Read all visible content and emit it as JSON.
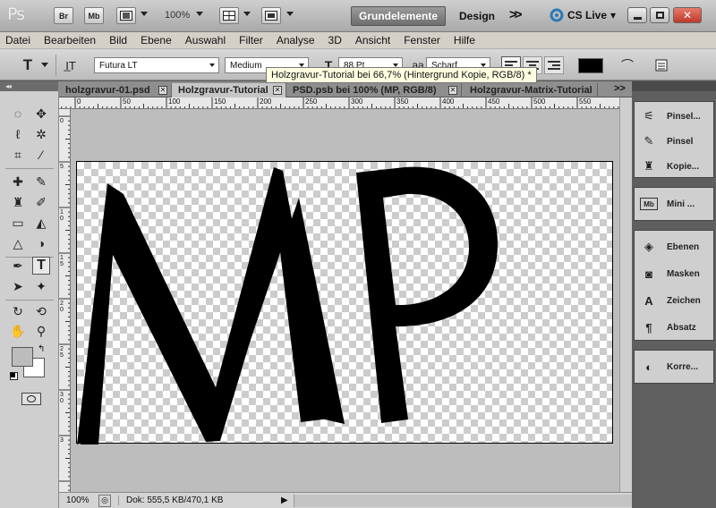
{
  "appbar": {
    "logo": "Ps",
    "bridge_label": "Br",
    "minibridge_label": "Mb",
    "zoom": "100%",
    "workspace_active": "Grundelemente",
    "workspace_other": "Design",
    "more_label": ">>",
    "cslive": "CS Live",
    "cslive_dropdown": "▾"
  },
  "menu": [
    "Datei",
    "Bearbeiten",
    "Bild",
    "Ebene",
    "Auswahl",
    "Filter",
    "Analyse",
    "3D",
    "Ansicht",
    "Fenster",
    "Hilfe"
  ],
  "options": {
    "font_family": "Futura LT",
    "font_style": "Medium",
    "font_size": "88 Pt",
    "antialias": "Scharf"
  },
  "tooltip": "Holzgravur-Tutorial bei 66,7% (Hintergrund Kopie, RGB/8) *",
  "tabs": [
    {
      "label": "holzgravur-01.psd"
    },
    {
      "label": "Holzgravur-Tutorial"
    },
    {
      "label": "PSD.psb bei 100% (MP, RGB/8)"
    },
    {
      "label": "Holzgravur-Matrix-Tutorial"
    }
  ],
  "tabs_overflow": ">>",
  "ruler": {
    "top_ticks": [
      "0",
      "50",
      "100",
      "150",
      "200",
      "250",
      "300",
      "350",
      "400",
      "450",
      "500",
      "550",
      "6"
    ],
    "left_ticks": [
      "0",
      "5",
      "1 0",
      "1 5",
      "2 0",
      "2 5",
      "3 0",
      "3"
    ]
  },
  "canvas": {
    "text": "MP"
  },
  "status": {
    "zoom": "100%",
    "doc_info": "Dok: 555,5 KB/470,1 KB",
    "arrow": "▶"
  },
  "panels": [
    {
      "items": [
        {
          "label": "Pinsel...",
          "icon": "brush-presets-icon"
        },
        {
          "label": "Pinsel",
          "icon": "brush-icon"
        },
        {
          "label": "Kopie...",
          "icon": "clone-source-icon"
        }
      ]
    },
    {
      "items": [
        {
          "label": "Mini ...",
          "icon": "mini-bridge-icon"
        }
      ]
    },
    {
      "items": [
        {
          "label": "Ebenen",
          "icon": "layers-icon"
        },
        {
          "label": "Masken",
          "icon": "masks-icon"
        },
        {
          "label": "Zeichen",
          "icon": "character-icon"
        },
        {
          "label": "Absatz",
          "icon": "paragraph-icon"
        }
      ]
    },
    {
      "items": [
        {
          "label": "Korre...",
          "icon": "adjustments-icon"
        }
      ]
    }
  ],
  "colors": {
    "appbar": "#b9b9b9",
    "workspace_active": "#7f7f7f",
    "close_button": "#c0392b",
    "cslive_icon": "#2a7ab8",
    "tooltip": "#ffffe1",
    "canvas_text": "#000000"
  }
}
